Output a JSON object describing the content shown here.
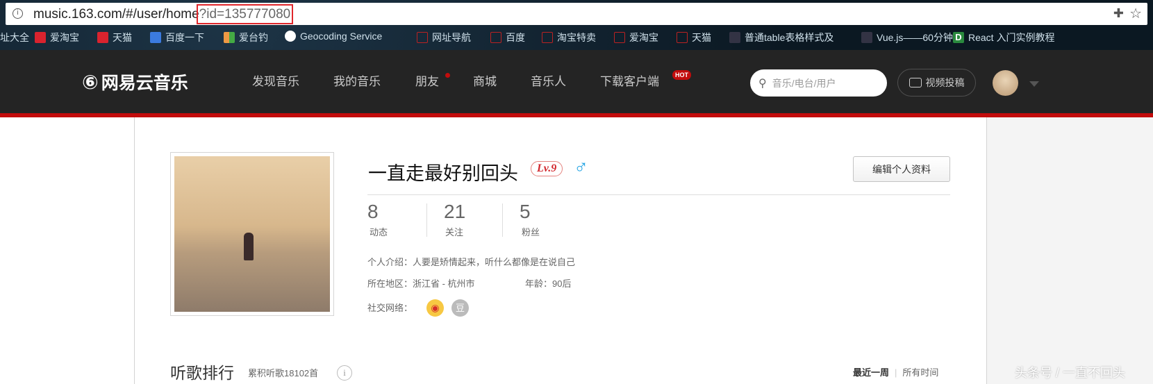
{
  "browser": {
    "url_base": "music.163.com/#/user/home",
    "url_query": "?id=135777080",
    "bookmarks": [
      "址大全",
      "爱淘宝",
      "天猫",
      "百度一下",
      "爱台钓",
      "Geocoding Service",
      "网址导航",
      "百度",
      "淘宝特卖",
      "爱淘宝",
      "天猫",
      "普通table表格样式及",
      "Vue.js——60分钟快",
      "React 入门实例教程"
    ]
  },
  "nav": {
    "logo": "网易云音乐",
    "items": [
      "发现音乐",
      "我的音乐",
      "朋友",
      "商城",
      "音乐人",
      "下载客户端"
    ],
    "hot_badge": "HOT",
    "search_placeholder": "音乐/电台/用户",
    "video_button": "视频投稿"
  },
  "profile": {
    "name": "一直走最好别回头",
    "level": "Lv.9",
    "gender": "♂",
    "edit_button": "编辑个人资料",
    "stats": [
      {
        "value": "8",
        "label": "动态"
      },
      {
        "value": "21",
        "label": "关注"
      },
      {
        "value": "5",
        "label": "粉丝"
      }
    ],
    "intro": "个人介绍：人要是矫情起来，听什么都像是在说自己",
    "region": "所在地区：浙江省 - 杭州市",
    "age": "年龄：90后",
    "social_label": "社交网络："
  },
  "ranking": {
    "title": "听歌排行",
    "count": "累积听歌18102首",
    "tab_week": "最近一周",
    "tab_all": "所有时间"
  },
  "watermark": "头条号 / 一直不回头",
  "colors": {
    "accent": "#c20c0c",
    "nav_bg": "#242424"
  }
}
